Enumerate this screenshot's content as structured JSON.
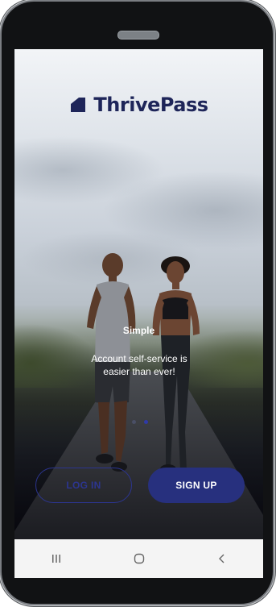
{
  "app": {
    "brand_name": "ThrivePass",
    "brand_color": "#1e2559"
  },
  "onboarding": {
    "slide_title": "Simple",
    "slide_text": "Account self-service is easier than ever!",
    "dots_total": 2,
    "active_dot": 2
  },
  "actions": {
    "login_label": "LOG IN",
    "signup_label": "SIGN UP",
    "accent_color": "#27307e"
  },
  "system_nav": {
    "buttons": [
      "recent-apps-icon",
      "home-icon",
      "back-icon"
    ]
  }
}
